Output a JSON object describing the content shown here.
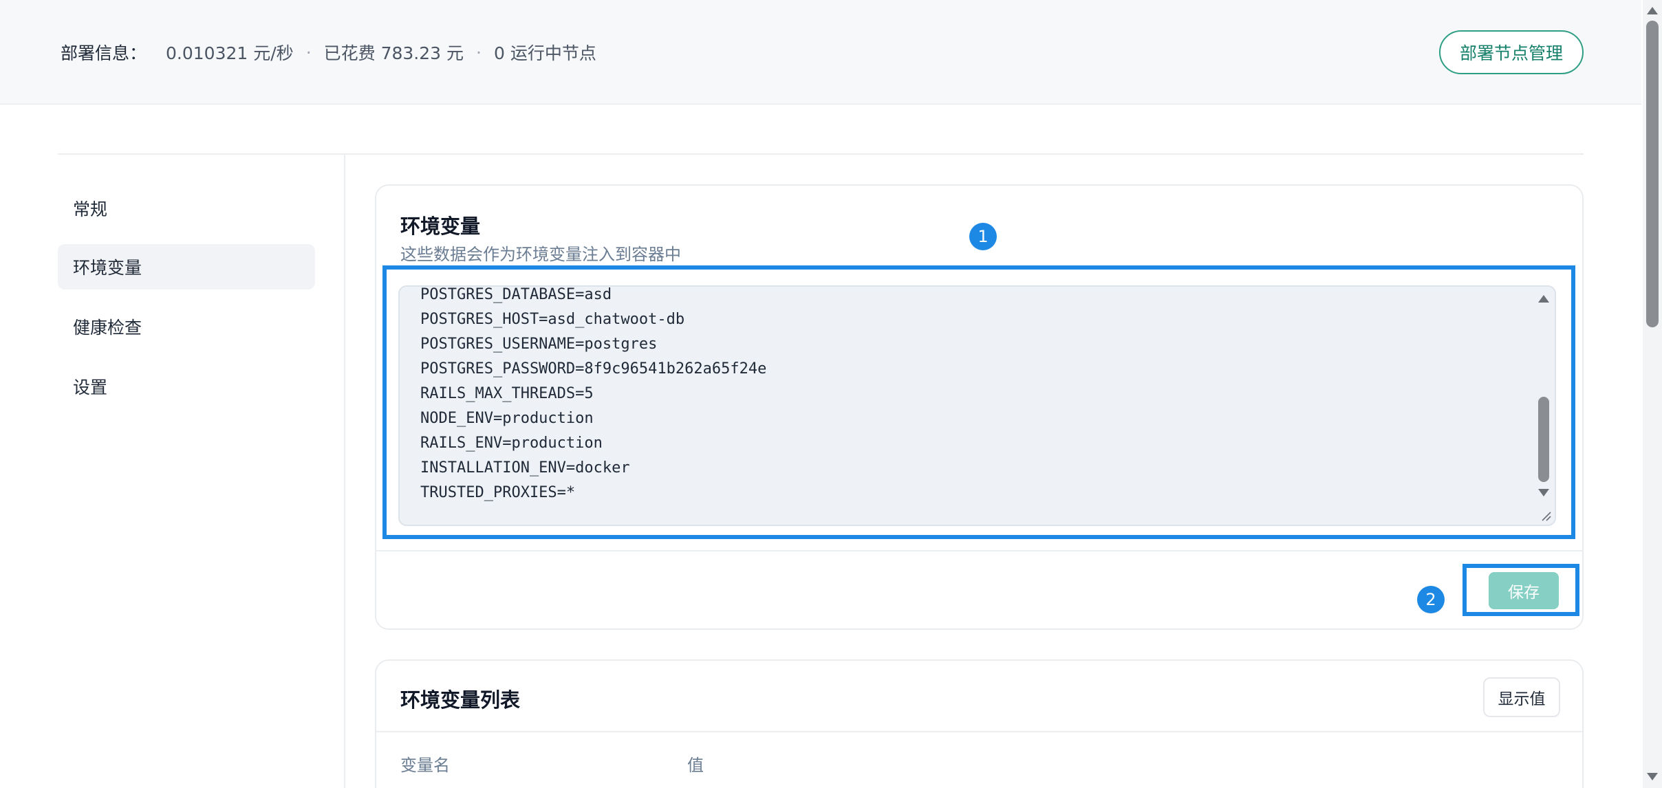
{
  "header": {
    "info_label": "部署信息：",
    "cost_rate": "0.010321 元/秒",
    "spent": "已花费 783.23 元",
    "running_nodes": "0 运行中节点",
    "separator": "·",
    "manage_button": "部署节点管理"
  },
  "sidebar": {
    "items": [
      {
        "label": "常规",
        "active": false
      },
      {
        "label": "环境变量",
        "active": true
      },
      {
        "label": "健康检查",
        "active": false
      },
      {
        "label": "设置",
        "active": false
      }
    ]
  },
  "env_editor": {
    "title": "环境变量",
    "subtitle": "这些数据会作为环境变量注入到容器中",
    "lines": [
      "POSTGRES_DATABASE=asd",
      "POSTGRES_HOST=asd_chatwoot-db",
      "POSTGRES_USERNAME=postgres",
      "POSTGRES_PASSWORD=8f9c96541b262a65f24e",
      "RAILS_MAX_THREADS=5",
      "NODE_ENV=production",
      "RAILS_ENV=production",
      "INSTALLATION_ENV=docker",
      "TRUSTED_PROXIES=*"
    ],
    "save_button": "保存"
  },
  "annotations": {
    "badge1": "1",
    "badge2": "2",
    "highlight_color": "#1e88e5"
  },
  "env_list": {
    "title": "环境变量列表",
    "show_values_button": "显示值",
    "columns": [
      "变量名",
      "值"
    ]
  },
  "colors": {
    "accent": "#2f9e85",
    "save_button_disabled": "#86cfc4"
  }
}
